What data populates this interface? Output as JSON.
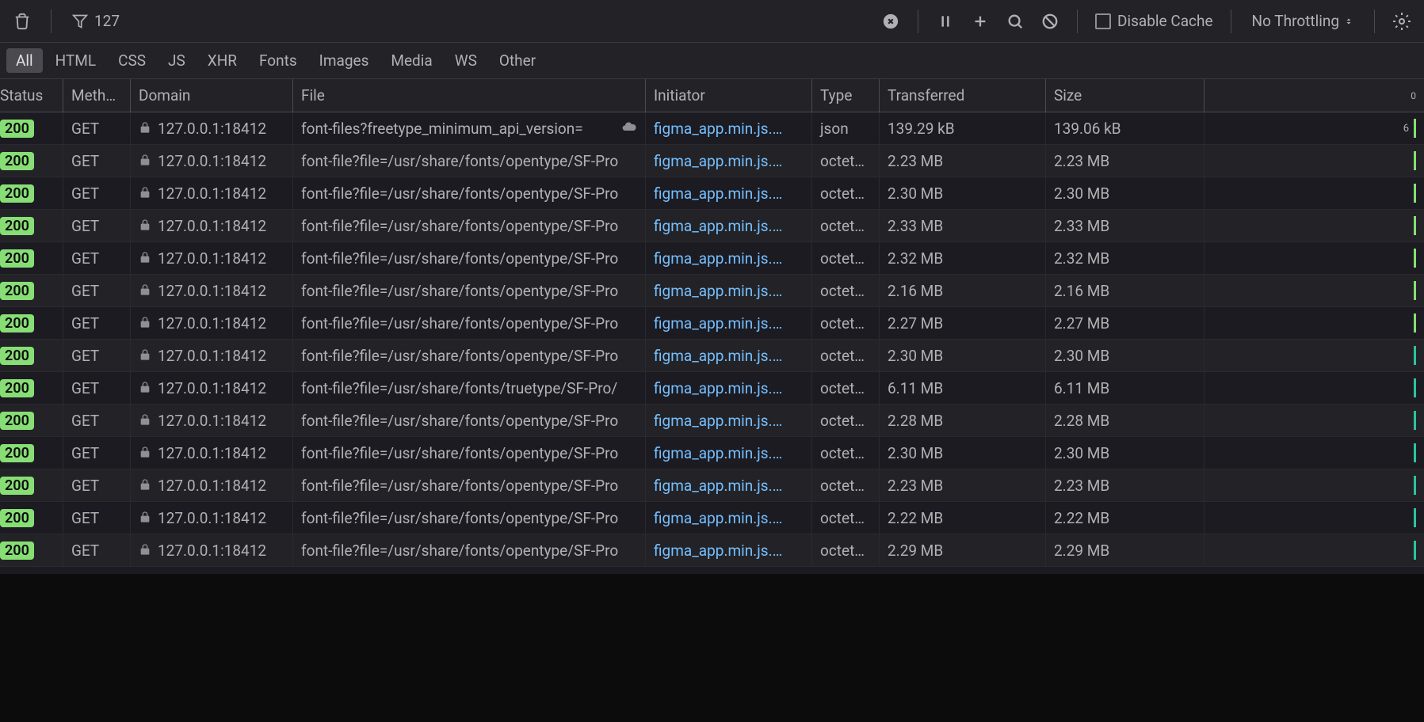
{
  "toolbar": {
    "filter_value": "127",
    "disable_cache_label": "Disable Cache",
    "throttling_label": "No Throttling"
  },
  "filter_tabs": [
    "All",
    "HTML",
    "CSS",
    "JS",
    "XHR",
    "Fonts",
    "Images",
    "Media",
    "WS",
    "Other"
  ],
  "active_filter": "All",
  "columns": {
    "status": "Status",
    "method": "Meth…",
    "domain": "Domain",
    "file": "File",
    "initiator": "Initiator",
    "type": "Type",
    "transferred": "Transferred",
    "size": "Size",
    "waterfall_label": "0"
  },
  "requests": [
    {
      "status": "200",
      "method": "GET",
      "domain": "127.0.0.1:18412",
      "file": "font-files?freetype_minimum_api_version=",
      "initiator": "figma_app.min.js.…",
      "type": "json",
      "transferred": "139.29 kB",
      "size": "139.06 kB",
      "wf": "6",
      "has_cloud": true,
      "bar": "green"
    },
    {
      "status": "200",
      "method": "GET",
      "domain": "127.0.0.1:18412",
      "file": "font-file?file=/usr/share/fonts/opentype/SF-Pro",
      "initiator": "figma_app.min.js.…",
      "type": "octet…",
      "transferred": "2.23 MB",
      "size": "2.23 MB",
      "wf": "",
      "has_cloud": false,
      "bar": "green"
    },
    {
      "status": "200",
      "method": "GET",
      "domain": "127.0.0.1:18412",
      "file": "font-file?file=/usr/share/fonts/opentype/SF-Pro",
      "initiator": "figma_app.min.js.…",
      "type": "octet…",
      "transferred": "2.30 MB",
      "size": "2.30 MB",
      "wf": "",
      "has_cloud": false,
      "bar": "green"
    },
    {
      "status": "200",
      "method": "GET",
      "domain": "127.0.0.1:18412",
      "file": "font-file?file=/usr/share/fonts/opentype/SF-Pro",
      "initiator": "figma_app.min.js.…",
      "type": "octet…",
      "transferred": "2.33 MB",
      "size": "2.33 MB",
      "wf": "",
      "has_cloud": false,
      "bar": "green"
    },
    {
      "status": "200",
      "method": "GET",
      "domain": "127.0.0.1:18412",
      "file": "font-file?file=/usr/share/fonts/opentype/SF-Pro",
      "initiator": "figma_app.min.js.…",
      "type": "octet…",
      "transferred": "2.32 MB",
      "size": "2.32 MB",
      "wf": "",
      "has_cloud": false,
      "bar": "green"
    },
    {
      "status": "200",
      "method": "GET",
      "domain": "127.0.0.1:18412",
      "file": "font-file?file=/usr/share/fonts/opentype/SF-Pro",
      "initiator": "figma_app.min.js.…",
      "type": "octet…",
      "transferred": "2.16 MB",
      "size": "2.16 MB",
      "wf": "",
      "has_cloud": false,
      "bar": "green"
    },
    {
      "status": "200",
      "method": "GET",
      "domain": "127.0.0.1:18412",
      "file": "font-file?file=/usr/share/fonts/opentype/SF-Pro",
      "initiator": "figma_app.min.js.…",
      "type": "octet…",
      "transferred": "2.27 MB",
      "size": "2.27 MB",
      "wf": "",
      "has_cloud": false,
      "bar": "green"
    },
    {
      "status": "200",
      "method": "GET",
      "domain": "127.0.0.1:18412",
      "file": "font-file?file=/usr/share/fonts/opentype/SF-Pro",
      "initiator": "figma_app.min.js.…",
      "type": "octet…",
      "transferred": "2.30 MB",
      "size": "2.30 MB",
      "wf": "",
      "has_cloud": false,
      "bar": "teal"
    },
    {
      "status": "200",
      "method": "GET",
      "domain": "127.0.0.1:18412",
      "file": "font-file?file=/usr/share/fonts/truetype/SF-Pro/",
      "initiator": "figma_app.min.js.…",
      "type": "octet…",
      "transferred": "6.11 MB",
      "size": "6.11 MB",
      "wf": "",
      "has_cloud": false,
      "bar": "teal"
    },
    {
      "status": "200",
      "method": "GET",
      "domain": "127.0.0.1:18412",
      "file": "font-file?file=/usr/share/fonts/opentype/SF-Pro",
      "initiator": "figma_app.min.js.…",
      "type": "octet…",
      "transferred": "2.28 MB",
      "size": "2.28 MB",
      "wf": "",
      "has_cloud": false,
      "bar": "teal"
    },
    {
      "status": "200",
      "method": "GET",
      "domain": "127.0.0.1:18412",
      "file": "font-file?file=/usr/share/fonts/opentype/SF-Pro",
      "initiator": "figma_app.min.js.…",
      "type": "octet…",
      "transferred": "2.30 MB",
      "size": "2.30 MB",
      "wf": "",
      "has_cloud": false,
      "bar": "teal"
    },
    {
      "status": "200",
      "method": "GET",
      "domain": "127.0.0.1:18412",
      "file": "font-file?file=/usr/share/fonts/opentype/SF-Pro",
      "initiator": "figma_app.min.js.…",
      "type": "octet…",
      "transferred": "2.23 MB",
      "size": "2.23 MB",
      "wf": "",
      "has_cloud": false,
      "bar": "teal"
    },
    {
      "status": "200",
      "method": "GET",
      "domain": "127.0.0.1:18412",
      "file": "font-file?file=/usr/share/fonts/opentype/SF-Pro",
      "initiator": "figma_app.min.js.…",
      "type": "octet…",
      "transferred": "2.22 MB",
      "size": "2.22 MB",
      "wf": "",
      "has_cloud": false,
      "bar": "teal"
    },
    {
      "status": "200",
      "method": "GET",
      "domain": "127.0.0.1:18412",
      "file": "font-file?file=/usr/share/fonts/opentype/SF-Pro",
      "initiator": "figma_app.min.js.…",
      "type": "octet…",
      "transferred": "2.29 MB",
      "size": "2.29 MB",
      "wf": "",
      "has_cloud": false,
      "bar": "teal"
    }
  ]
}
